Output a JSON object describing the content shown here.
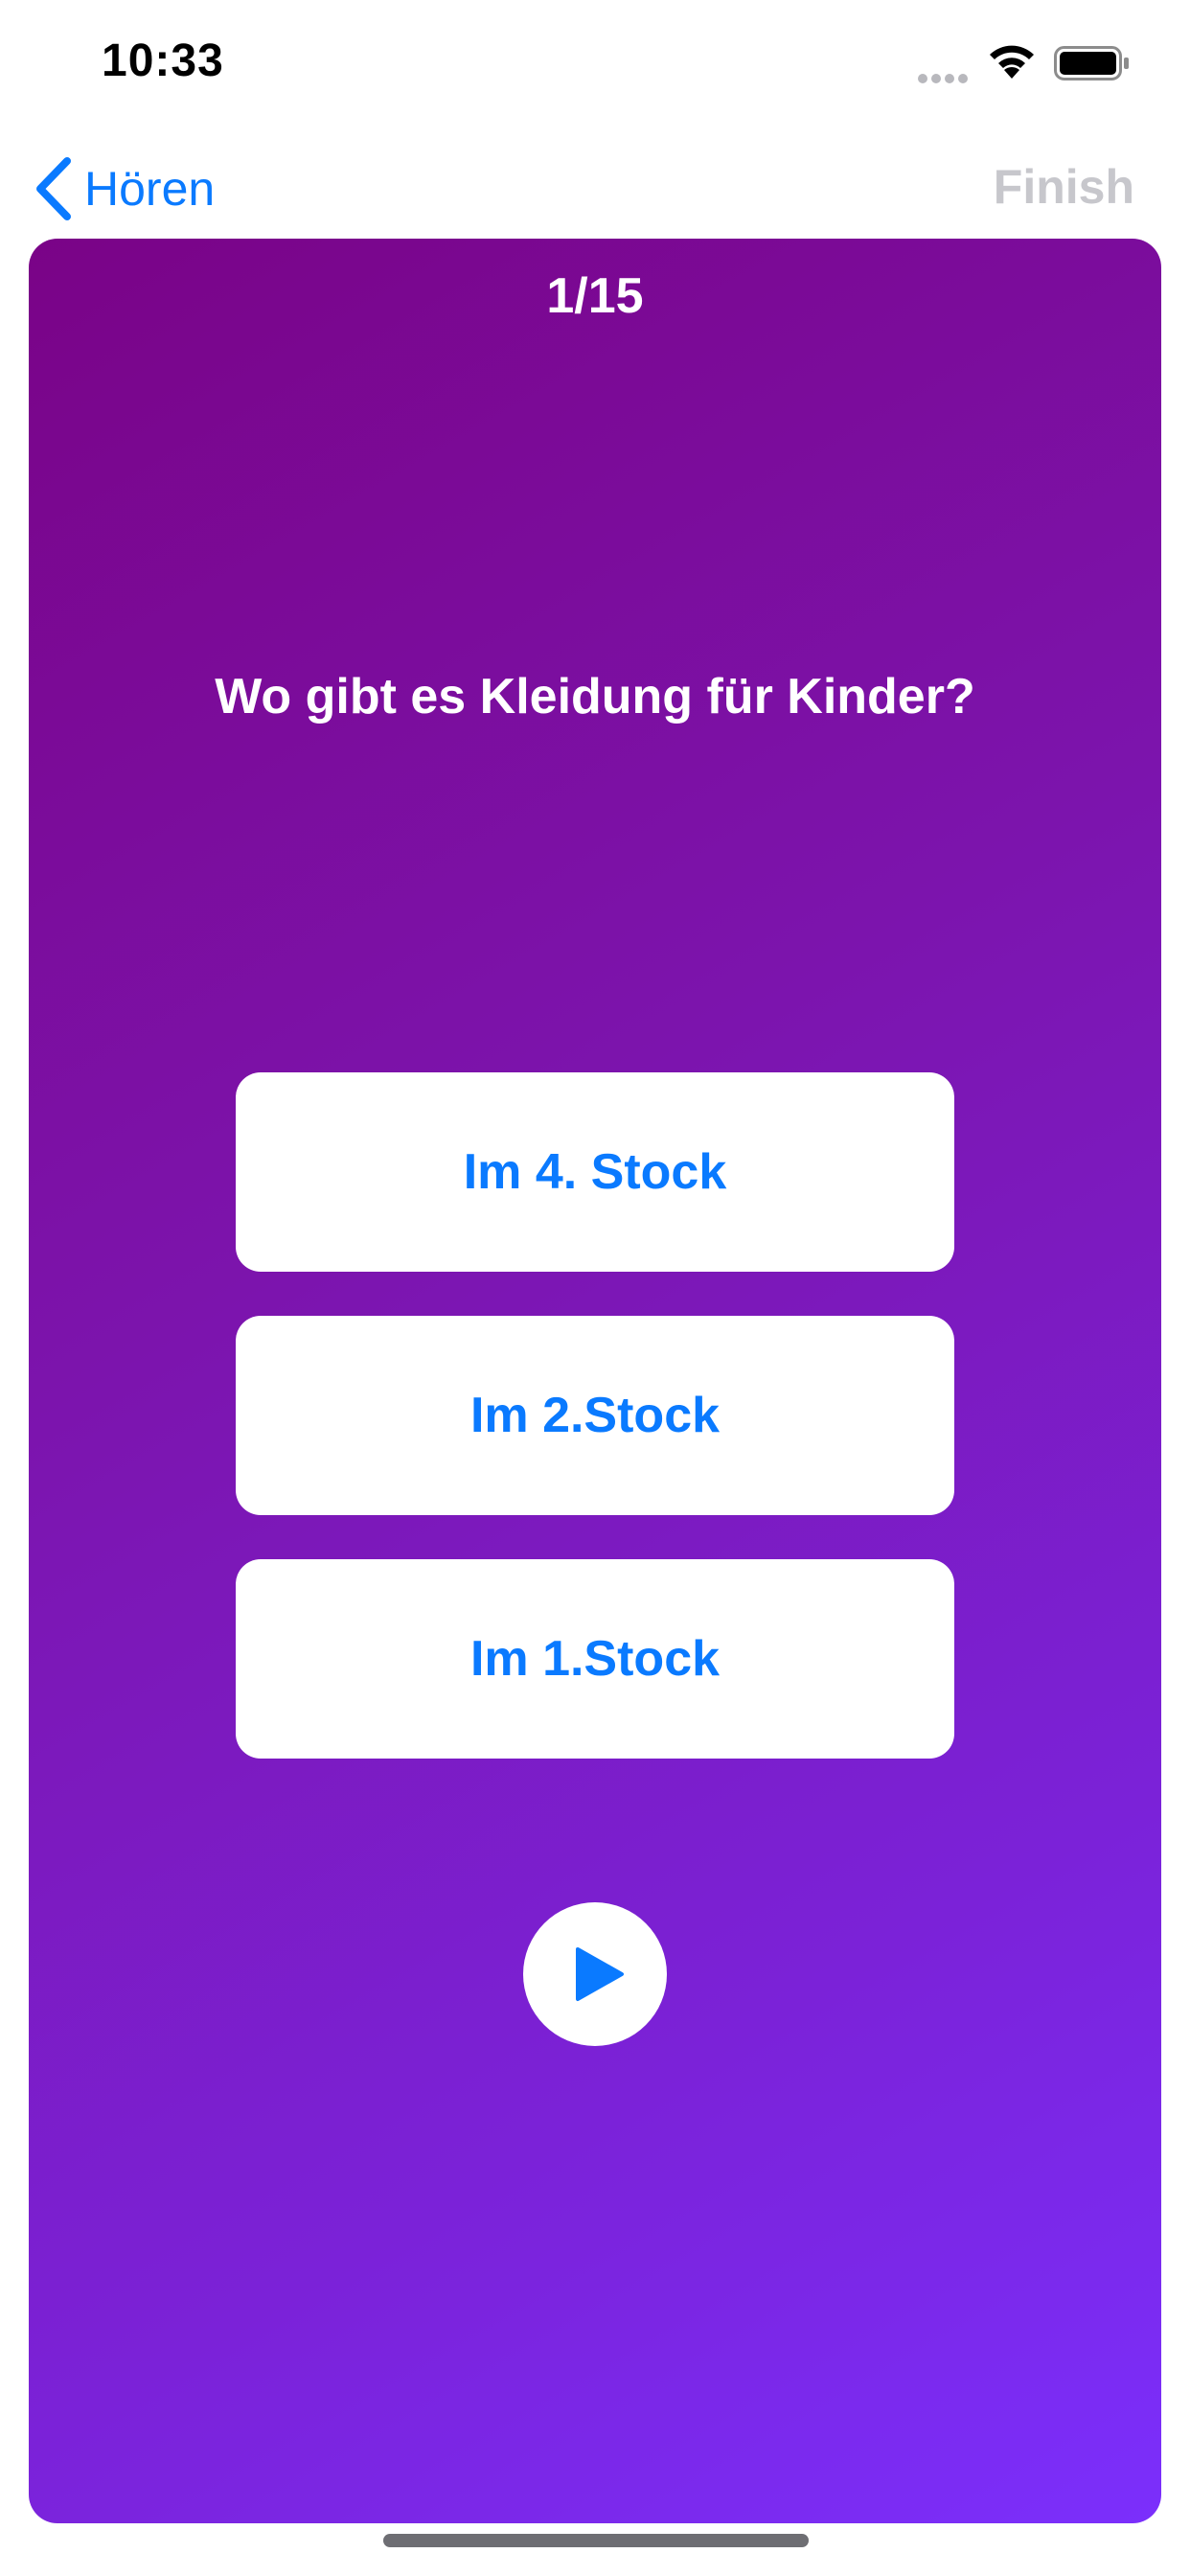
{
  "status_bar": {
    "time": "10:33"
  },
  "nav": {
    "back_label": "Hören",
    "finish_label": "Finish"
  },
  "quiz": {
    "progress": "1/15",
    "question": "Wo gibt es Kleidung für Kinder?",
    "answers": [
      {
        "label": "Im 4. Stock"
      },
      {
        "label": "Im 2.Stock"
      },
      {
        "label": "Im 1.Stock"
      }
    ],
    "play_icon": "play-icon"
  },
  "colors": {
    "accent": "#0a7aff",
    "finish_disabled": "#c7c7cc",
    "gradient_start": "#7a0387",
    "gradient_end": "#7b2ffc"
  }
}
